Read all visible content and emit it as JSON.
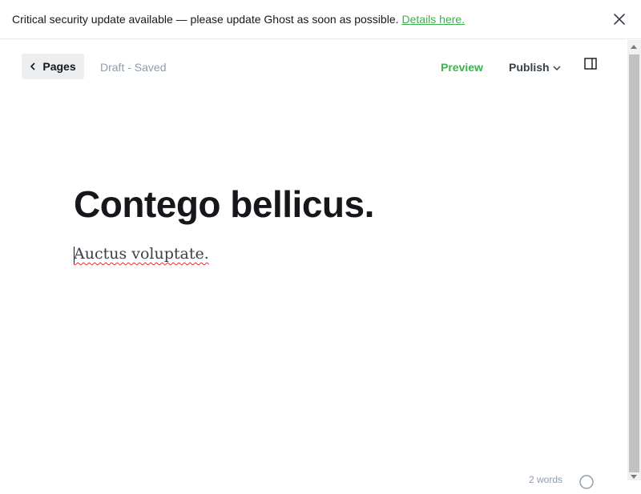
{
  "banner": {
    "message": "Critical security update available — please update Ghost as soon as possible.",
    "link_text": "Details here.",
    "close_icon": "close-icon"
  },
  "toolbar": {
    "back_label": "Pages",
    "status": "Draft - Saved",
    "preview_label": "Preview",
    "publish_label": "Publish",
    "sidebar_icon": "sidebar-toggle-icon"
  },
  "editor": {
    "title": "Contego bellicus.",
    "body": "Auctus voluptate."
  },
  "footer": {
    "word_count": "2 words",
    "help_icon": "help-icon"
  },
  "colors": {
    "accent": "#3eb04f",
    "text": "#15171a",
    "muted": "#8e9cac"
  }
}
